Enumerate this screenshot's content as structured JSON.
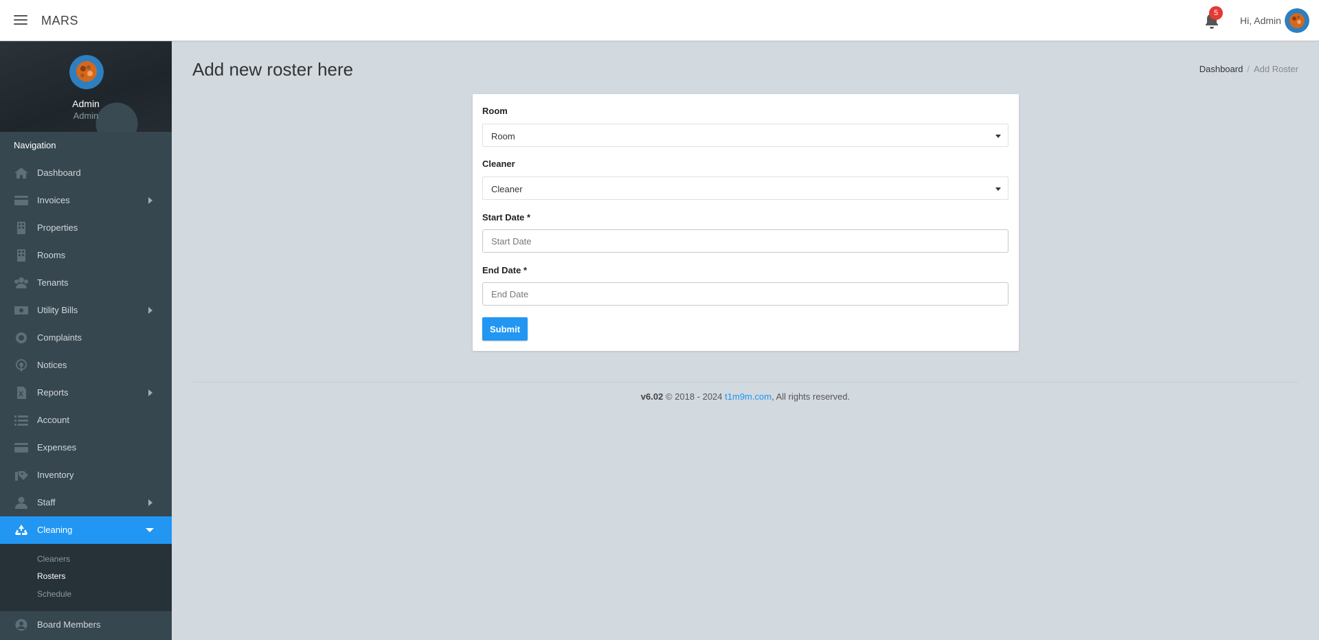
{
  "app": {
    "brand": "MARS"
  },
  "header": {
    "notification_count": "5",
    "greeting": "Hi, Admin"
  },
  "sidebar": {
    "profile": {
      "name": "Admin",
      "role": "Admin"
    },
    "nav_heading": "Navigation",
    "items": [
      {
        "label": "Dashboard",
        "icon": "home-icon",
        "has_submenu": false
      },
      {
        "label": "Invoices",
        "icon": "credit-card-icon",
        "has_submenu": true
      },
      {
        "label": "Properties",
        "icon": "building-icon",
        "has_submenu": false
      },
      {
        "label": "Rooms",
        "icon": "building-icon",
        "has_submenu": false
      },
      {
        "label": "Tenants",
        "icon": "users-icon",
        "has_submenu": false
      },
      {
        "label": "Utility Bills",
        "icon": "money-icon",
        "has_submenu": true
      },
      {
        "label": "Complaints",
        "icon": "lifebuoy-icon",
        "has_submenu": false
      },
      {
        "label": "Notices",
        "icon": "podcast-icon",
        "has_submenu": false
      },
      {
        "label": "Reports",
        "icon": "file-excel-icon",
        "has_submenu": true
      },
      {
        "label": "Account",
        "icon": "list-icon",
        "has_submenu": false
      },
      {
        "label": "Expenses",
        "icon": "credit-card-icon",
        "has_submenu": false
      },
      {
        "label": "Inventory",
        "icon": "tag-hand-icon",
        "has_submenu": false
      },
      {
        "label": "Staff",
        "icon": "user-icon",
        "has_submenu": true
      },
      {
        "label": "Cleaning",
        "icon": "recycle-icon",
        "has_submenu": true,
        "active": true
      },
      {
        "label": "Board Members",
        "icon": "user-circle-icon",
        "has_submenu": false
      }
    ],
    "cleaning_submenu": [
      {
        "label": "Cleaners"
      },
      {
        "label": "Rosters",
        "current": true
      },
      {
        "label": "Schedule"
      }
    ]
  },
  "page": {
    "title": "Add new roster here",
    "breadcrumb": {
      "home": "Dashboard",
      "current": "Add Roster"
    }
  },
  "form": {
    "room_label": "Room",
    "room_value": "Room",
    "cleaner_label": "Cleaner",
    "cleaner_value": "Cleaner",
    "start_label": "Start Date *",
    "start_placeholder": "Start Date",
    "end_label": "End Date *",
    "end_placeholder": "End Date",
    "submit_label": "Submit"
  },
  "footer": {
    "version": "v6.02",
    "copyright": "© 2018 - 2024",
    "link": "t1m9m.com",
    "rights": ", All rights reserved."
  },
  "colors": {
    "accent": "#2196f3",
    "sidebar_bg": "#37474f",
    "submenu_bg": "#263238",
    "page_bg": "#d2d9df",
    "badge": "#e53935"
  }
}
